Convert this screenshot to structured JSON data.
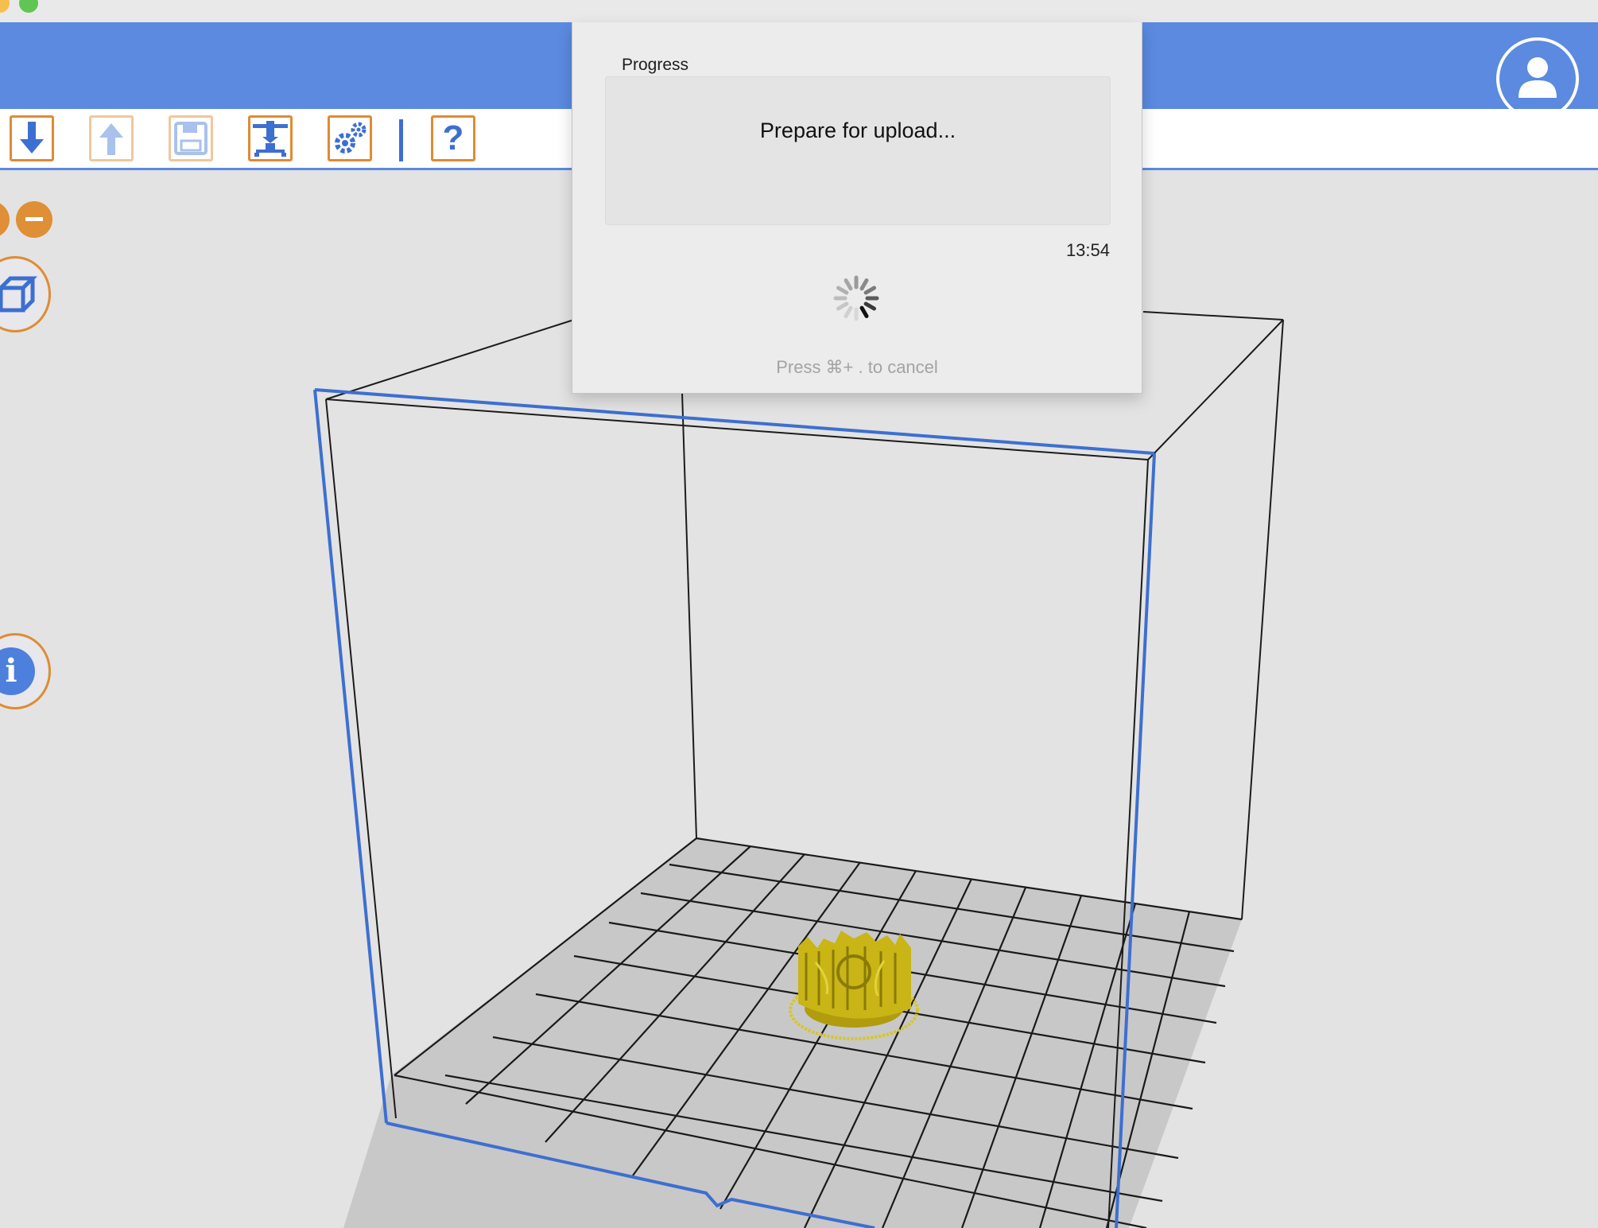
{
  "window": {
    "traffic_lights": [
      "minimize",
      "zoom"
    ]
  },
  "header": {
    "user_icon": "user-icon"
  },
  "toolbar": {
    "buttons": [
      {
        "name": "load-button",
        "icon": "download-arrow-icon",
        "enabled": true
      },
      {
        "name": "export-button",
        "icon": "upload-arrow-icon",
        "enabled": false
      },
      {
        "name": "save-button",
        "icon": "floppy-disk-icon",
        "enabled": false
      },
      {
        "name": "print-button",
        "icon": "printer-icon",
        "enabled": true
      },
      {
        "name": "settings-button",
        "icon": "gears-icon",
        "enabled": true
      },
      {
        "name": "help-button",
        "icon": "question-mark-icon",
        "enabled": true
      }
    ],
    "help_label": "?"
  },
  "side": {
    "zoom_out_icon": "minus-icon",
    "view_icon": "cube-icon",
    "info_label": "i"
  },
  "dialog": {
    "group_label": "Progress",
    "message": "Prepare for upload...",
    "elapsed": "13:54",
    "cancel_hint": "Press ⌘+ . to cancel"
  },
  "colors": {
    "header_blue": "#5b8ae0",
    "accent_orange": "#de8c33",
    "model_yellow": "#c9b515",
    "build_volume_blue": "#3d6fd0"
  }
}
